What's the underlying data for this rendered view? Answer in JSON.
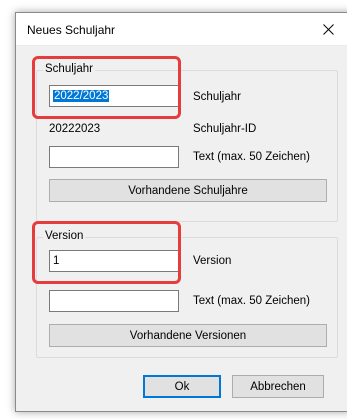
{
  "window": {
    "title": "Neues Schuljahr",
    "close_label": "Close"
  },
  "schuljahr_group": {
    "legend": "Schuljahr",
    "input_value": "2022/2023",
    "input_label": "Schuljahr",
    "id_value": "20222023",
    "id_label": "Schuljahr-ID",
    "text_value": "",
    "text_label": "Text (max. 50 Zeichen)",
    "list_button": "Vorhandene Schuljahre"
  },
  "version_group": {
    "legend": "Version",
    "input_value": "1",
    "input_label": "Version",
    "text_value": "",
    "text_label": "Text (max. 50 Zeichen)",
    "list_button": "Vorhandene Versionen"
  },
  "footer": {
    "ok_label": "Ok",
    "cancel_label": "Abbrechen"
  },
  "annotation_color": "#e53c3c"
}
